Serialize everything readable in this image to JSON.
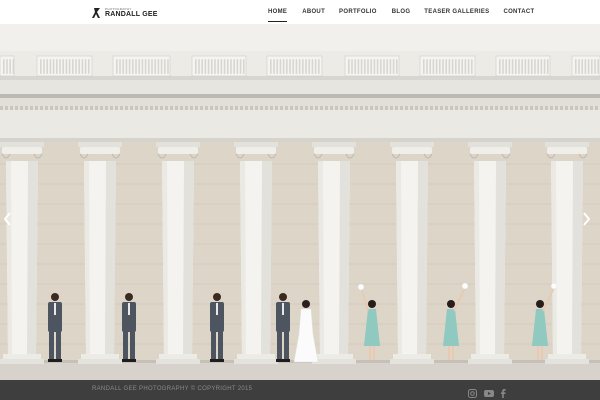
{
  "brand": {
    "logo_small": "PHOTOGRAPHY",
    "logo_name": "RANDALL GEE"
  },
  "nav": {
    "items": [
      "HOME",
      "ABOUT",
      "PORTFOLIO",
      "BLOG",
      "TEASER GALLERIES",
      "CONTACT"
    ],
    "active": "HOME"
  },
  "slider": {
    "prev_icon": "chevron-left-icon",
    "next_icon": "chevron-right-icon"
  },
  "footer": {
    "copyright": "RANDALL GEE PHOTOGRAPHY © COPYRIGHT 2015",
    "social_icons": [
      "instagram-icon",
      "youtube-icon",
      "facebook-icon"
    ]
  },
  "colors": {
    "nav_text": "#333333",
    "footer_bg": "#3e3e3e",
    "bridesmaid_dress": "#8fc9bf",
    "groomsman_suit": "#4d5560"
  }
}
